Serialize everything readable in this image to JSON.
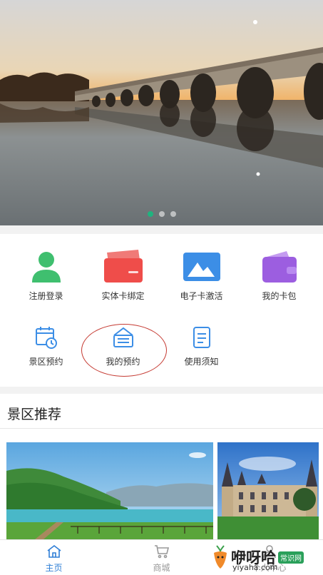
{
  "banner": {
    "slide_count": 3,
    "active_slide": 1
  },
  "services": {
    "row1": [
      {
        "label": "注册登录",
        "icon": "user-icon"
      },
      {
        "label": "实体卡绑定",
        "icon": "card-icon"
      },
      {
        "label": "电子卡激活",
        "icon": "ecard-icon"
      },
      {
        "label": "我的卡包",
        "icon": "wallet-icon"
      }
    ],
    "row2": [
      {
        "label": "景区预约",
        "icon": "calendar-clock-icon"
      },
      {
        "label": "我的预约",
        "icon": "reservation-icon"
      },
      {
        "label": "使用须知",
        "icon": "document-icon"
      }
    ]
  },
  "recommend": {
    "title": "景区推荐"
  },
  "tabbar": {
    "home": "主页",
    "mall": "商城",
    "profile": "个人中心"
  },
  "watermark": {
    "brand": "咿呀哈",
    "badge": "常识网",
    "domain": "yiyaha.com"
  },
  "colors": {
    "accent": "#2f7fd6",
    "dot_active": "#1fb47f",
    "user_icon": "#3fbf6f",
    "card_icon": "#ef4d4a",
    "ecard_icon": "#3c8ee6",
    "wallet_icon": "#9c5ee0"
  }
}
